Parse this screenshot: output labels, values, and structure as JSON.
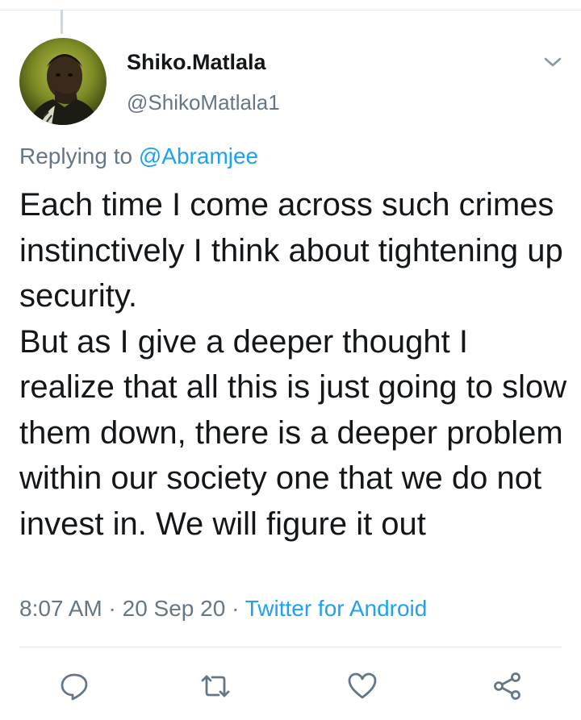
{
  "tweet": {
    "display_name": "Shiko.Matlala",
    "handle": "@ShikoMatlala1",
    "replying_prefix": "Replying to ",
    "replying_to": "@Abramjee",
    "text": "Each time I come across such crimes instinctively I think about tightening up security.\nBut as I give a deeper thought I realize that all this is just going to slow them down, there is a deeper problem within our society one that we do not invest in. We will figure it out",
    "time": "8:07 AM",
    "date": "20 Sep 20",
    "source": "Twitter for Android",
    "separator": " · "
  },
  "icons": {
    "more": "chevron-down-icon",
    "reply": "reply-icon",
    "retweet": "retweet-icon",
    "like": "heart-icon",
    "share": "share-icon"
  },
  "colors": {
    "accent": "#1da1f2",
    "secondary_text": "#657786",
    "primary_text": "#14171a",
    "divider": "#e1e8ed"
  }
}
